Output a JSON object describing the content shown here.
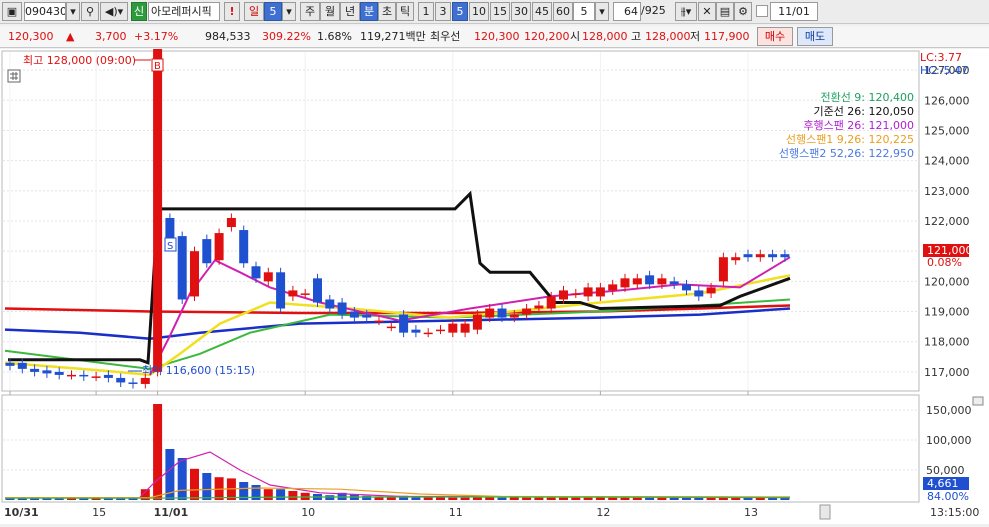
{
  "toolbar": {
    "code": "090430",
    "name_badge": "신",
    "name": "아모레퍼시픽",
    "exclaim": "!",
    "period_day": "일",
    "period_num": "5",
    "period_week": "주",
    "period_month": "월",
    "period_year": "년",
    "period_minute": "분",
    "period_second": "초",
    "period_tick": "틱",
    "intervals": [
      "1",
      "3",
      "5",
      "10",
      "15",
      "30",
      "45",
      "60"
    ],
    "interval_value": "5",
    "count": "64",
    "count_total": "/925",
    "date": "11/01"
  },
  "quote": {
    "price": "120,300",
    "arrow": "▲",
    "change": "3,700",
    "change_pct": "+3.17%",
    "volume": "984,533",
    "vol_ratio": "309.22%",
    "turnover": "1.68%",
    "amount": "119,271백만",
    "best_label": "최우선",
    "best_ask": "120,300",
    "best_bid": "120,200",
    "open_label": "시",
    "open": "128,000",
    "high_label": "고",
    "high": "128,000",
    "low_label": "저",
    "low": "117,900",
    "buy_label": "매수",
    "sell_label": "매도"
  },
  "indicators": {
    "lc": "LC:3.77",
    "hc": "HC:-5.47",
    "legend": [
      {
        "label": "전환선 9: 120,400",
        "color": "#1fa060"
      },
      {
        "label": "기준선 26: 120,050",
        "color": "#111111"
      },
      {
        "label": "후행스팬 26: 121,000",
        "color": "#b020d0"
      },
      {
        "label": "선행스팬1 9,26: 120,225",
        "color": "#e8a020"
      },
      {
        "label": "선행스팬2 52,26: 122,950",
        "color": "#4a7ae0"
      }
    ],
    "high_note": "최고 128,000 (09:00)",
    "low_note": "최저 116,600 (15:15)",
    "badge_b": "B",
    "badge_s": "S",
    "last_price": "121,000",
    "last_pct": "0.08%",
    "last_volume": "4,661",
    "last_vol_pct": "84.00%",
    "time_label": "13:15:00"
  },
  "chart_data": {
    "type": "candlestick",
    "price_ticks": [
      "127,000",
      "126,000",
      "125,000",
      "124,000",
      "123,000",
      "122,000",
      "121,000",
      "120,000",
      "119,000",
      "118,000",
      "117,000"
    ],
    "volume_ticks": [
      "150,000",
      "100,000",
      "50,000"
    ],
    "x_labels": [
      "10/31",
      "15",
      "11/01",
      "10",
      "11",
      "12",
      "13"
    ],
    "ylim": [
      116400,
      127600
    ],
    "candles": [
      [
        117300,
        117200
      ],
      [
        117300,
        117100
      ],
      [
        117100,
        117000
      ],
      [
        117050,
        116950
      ],
      [
        117000,
        116900
      ],
      [
        116900,
        116900
      ],
      [
        116900,
        116850
      ],
      [
        116850,
        116850
      ],
      [
        116900,
        116800
      ],
      [
        116800,
        116650
      ],
      [
        116650,
        116600
      ],
      [
        116600,
        116800
      ],
      [
        117000,
        128000
      ],
      [
        122100,
        121200
      ],
      [
        121500,
        119400
      ],
      [
        119500,
        121000
      ],
      [
        121400,
        120600
      ],
      [
        120700,
        121600
      ],
      [
        121800,
        122100
      ],
      [
        121700,
        120600
      ],
      [
        120500,
        120100
      ],
      [
        120000,
        120300
      ],
      [
        120300,
        119100
      ],
      [
        119500,
        119700
      ],
      [
        119600,
        119600
      ],
      [
        120100,
        119300
      ],
      [
        119400,
        119100
      ],
      [
        119300,
        118900
      ],
      [
        119000,
        118800
      ],
      [
        118900,
        118800
      ],
      [
        118700,
        118700
      ],
      [
        118500,
        118500
      ],
      [
        118900,
        118300
      ],
      [
        118400,
        118300
      ],
      [
        118300,
        118300
      ],
      [
        118400,
        118400
      ],
      [
        118300,
        118600
      ],
      [
        118300,
        118600
      ],
      [
        118400,
        118900
      ],
      [
        118800,
        119100
      ],
      [
        119100,
        118800
      ],
      [
        118800,
        118900
      ],
      [
        118900,
        119100
      ],
      [
        119100,
        119200
      ],
      [
        119100,
        119500
      ],
      [
        119400,
        119700
      ],
      [
        119600,
        119600
      ],
      [
        119500,
        119800
      ],
      [
        119500,
        119800
      ],
      [
        119700,
        119900
      ],
      [
        119800,
        120100
      ],
      [
        119900,
        120100
      ],
      [
        120200,
        119900
      ],
      [
        119900,
        120100
      ],
      [
        120000,
        119900
      ],
      [
        119900,
        119700
      ],
      [
        119700,
        119500
      ],
      [
        119600,
        119800
      ],
      [
        120000,
        120800
      ],
      [
        120700,
        120800
      ],
      [
        120900,
        120800
      ],
      [
        120800,
        120900
      ],
      [
        120900,
        120800
      ],
      [
        120900,
        120800
      ]
    ],
    "volumes": [
      5000,
      4000,
      3000,
      2500,
      3000,
      4000,
      3000,
      2500,
      3000,
      3000,
      5000,
      18000,
      160000,
      85000,
      70000,
      52000,
      45000,
      38000,
      36000,
      30000,
      25000,
      18000,
      18000,
      15000,
      12000,
      10000,
      8000,
      12000,
      9000,
      7000,
      6000,
      5000,
      7000,
      6000,
      5000,
      6000,
      4000,
      4000,
      5000,
      5000,
      4000,
      5000,
      4000,
      4000,
      4000,
      4000,
      4000,
      4000,
      5000,
      4000,
      4000,
      4000,
      4000,
      4000,
      4000,
      4000,
      5000,
      4000,
      6000,
      5000,
      5000,
      4000,
      5000,
      4661
    ]
  }
}
